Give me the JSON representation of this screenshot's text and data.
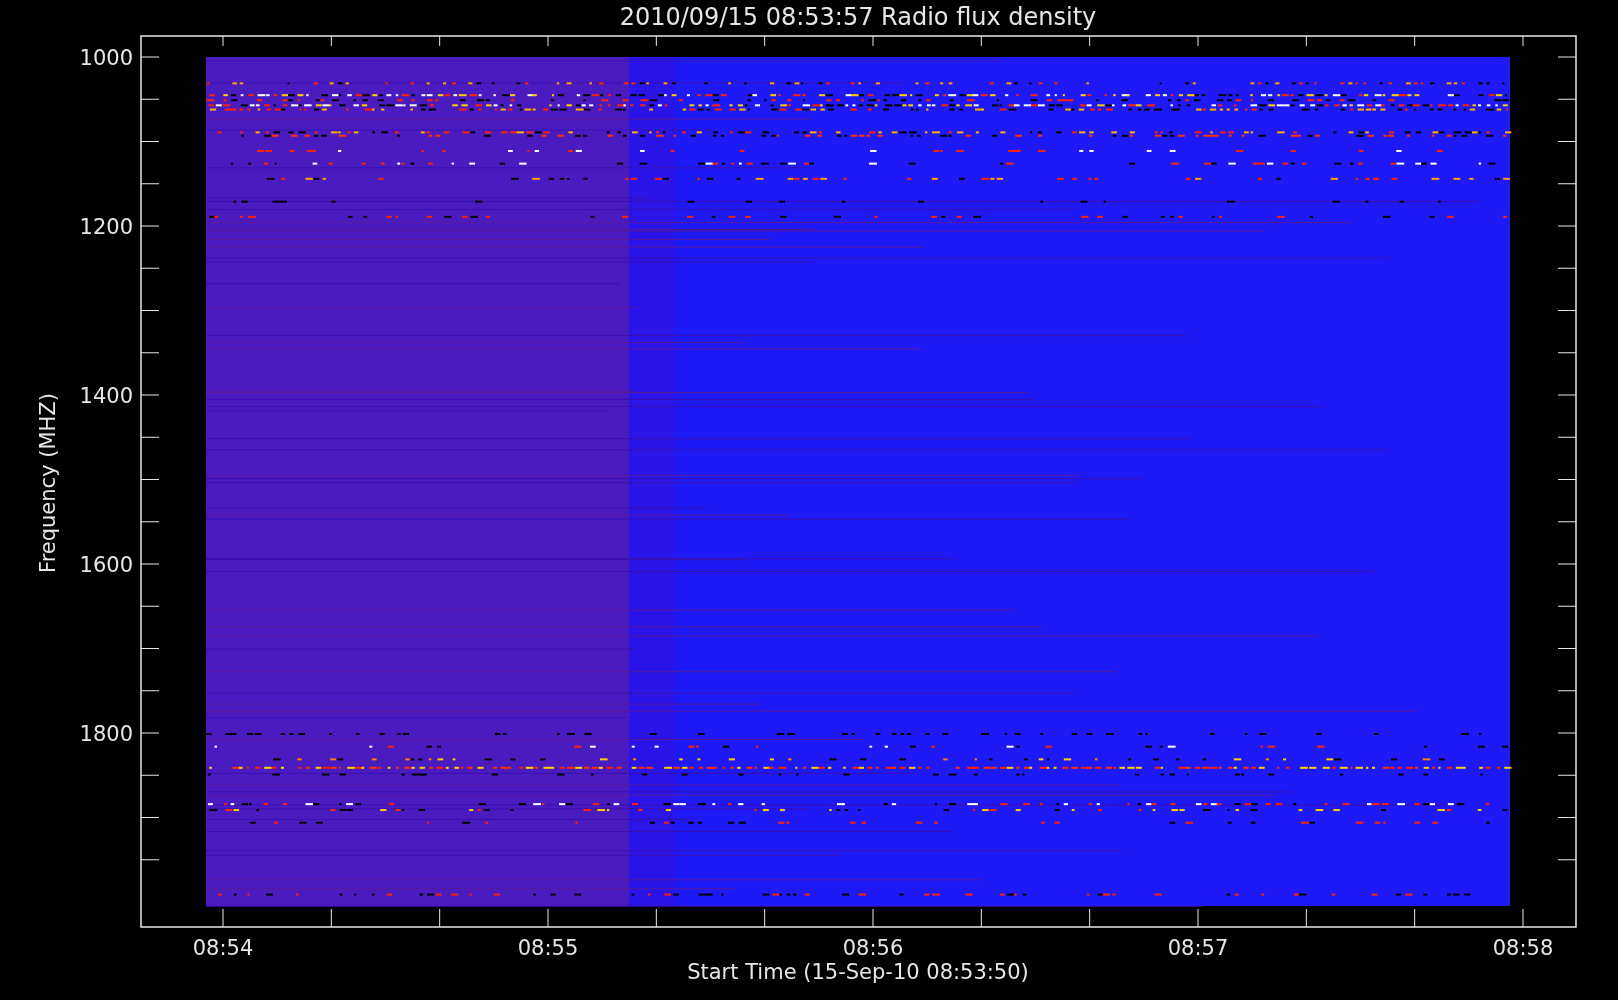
{
  "plot": {
    "title": "2010/09/15 08:53:57 Radio flux density",
    "ylabel": "Frequency (MHZ)",
    "xlabel": "Start Time (15-Sep-10 08:53:50)",
    "y_tick_labels": [
      "1000",
      "1200",
      "1400",
      "1600",
      "1800"
    ],
    "x_tick_labels": [
      "08:54",
      "08:55",
      "08:56",
      "08:57",
      "08:58"
    ]
  }
}
